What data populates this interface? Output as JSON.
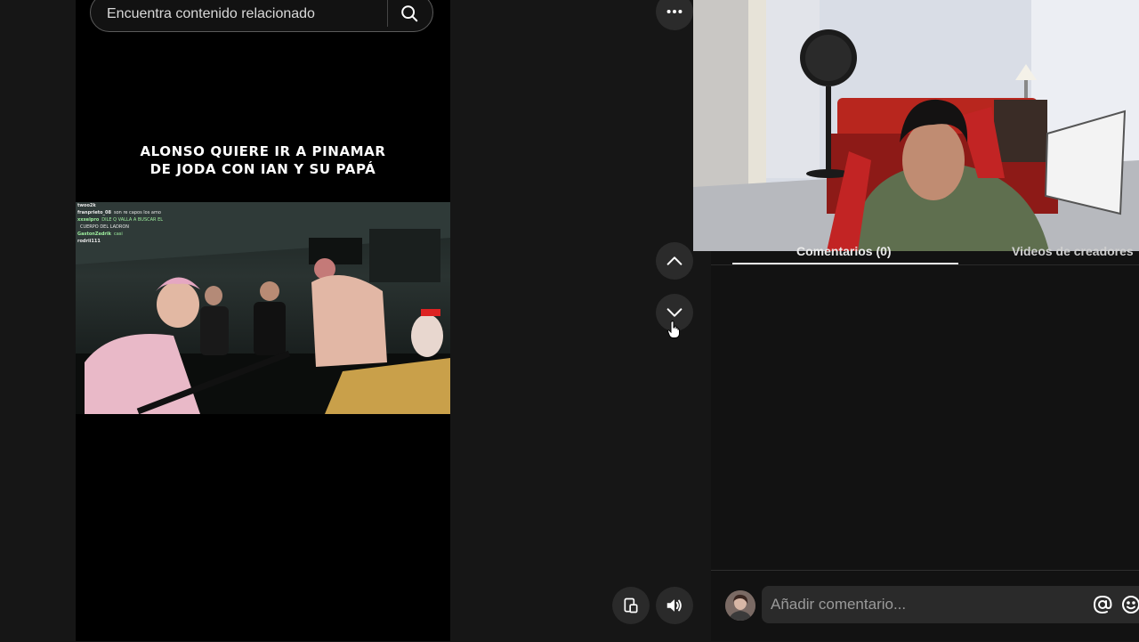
{
  "search": {
    "placeholder": "Encuentra contenido relacionado",
    "button_icon": "search-icon"
  },
  "video": {
    "caption_lines": [
      "ALONSO QUIERE IR A PINAMAR",
      "DE JODA CON IAN Y SU PAPÁ"
    ],
    "chat": [
      {
        "user": "twoo2k",
        "text": "",
        "color": "#ffffff"
      },
      {
        "user": "franprieto_08",
        "text": "son re capos los amo",
        "color": "#bbbbbb"
      },
      {
        "user": "xxxelpro",
        "text": "DILE Q VALLA A BUSCAR EL",
        "color": "#7fe87f"
      },
      {
        "user": "",
        "text": "CUERPO DEL LADRON",
        "color": "#ffffff"
      },
      {
        "user": "GastonZedrik",
        "text": "casi",
        "color": "#7fe87f"
      },
      {
        "user": "rodrii111",
        "text": "",
        "color": "#ffffff"
      }
    ]
  },
  "controls": {
    "more_icon": "more-horizontal-icon",
    "prev_icon": "chevron-up-icon",
    "next_icon": "chevron-down-icon",
    "pip_icon": "picture-in-picture-icon",
    "volume_icon": "volume-icon"
  },
  "comments": {
    "tab_label": "Comentarios (0)",
    "tab2_label": "Videos de creadores",
    "input_placeholder": "Añadir comentario...",
    "mention_icon": "at-sign-icon",
    "emoji_icon": "emoji-icon"
  },
  "colors": {
    "background": "#161616",
    "feed_bg": "#000000",
    "button_bg": "#2b2b2b",
    "panel_bg": "#121212"
  }
}
